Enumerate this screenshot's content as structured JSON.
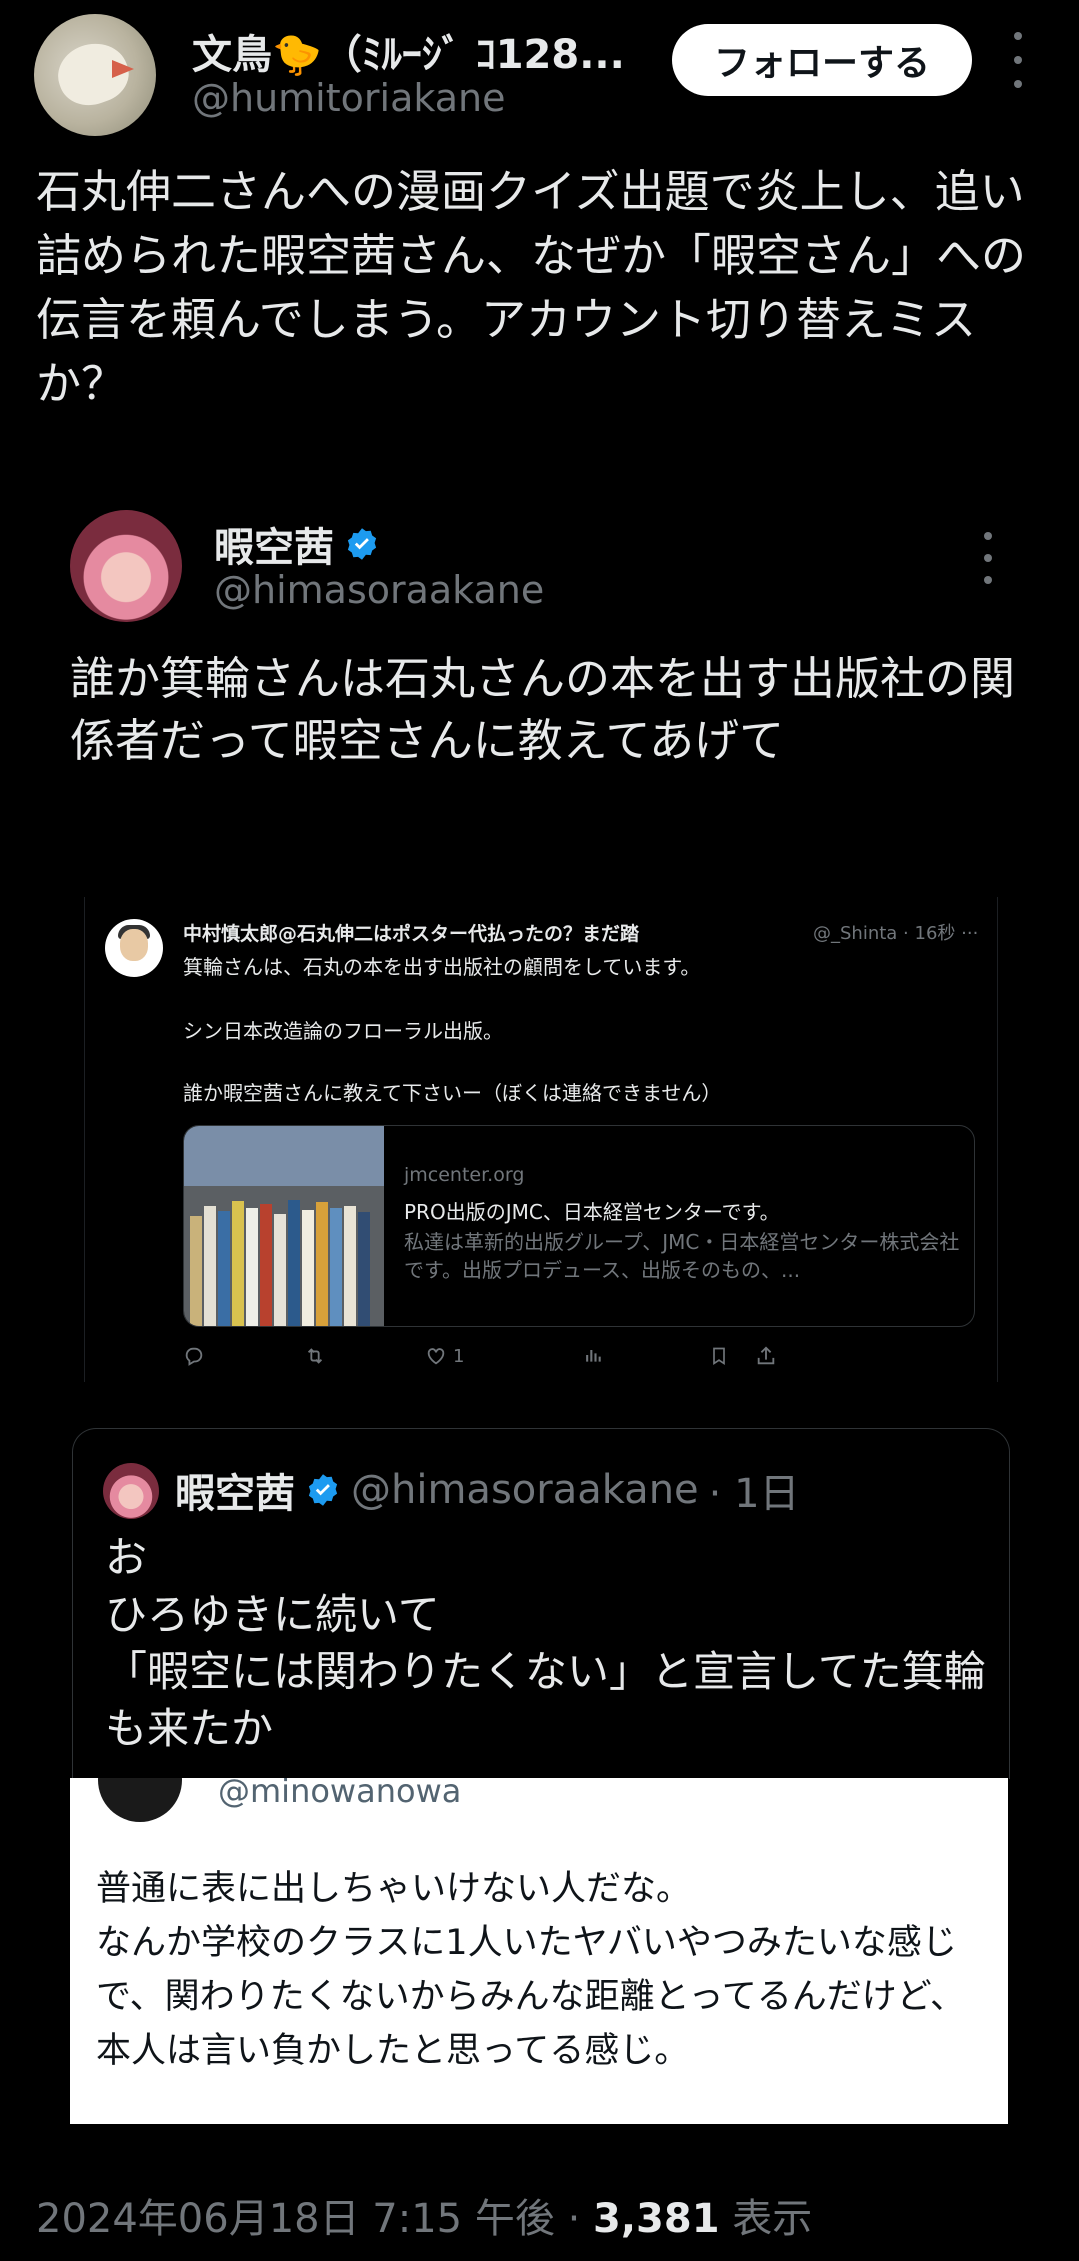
{
  "tweet": {
    "author_name": "文鳥🐤（ﾐﾙｰｼﾞ ｺ128...",
    "author_handle": "@humitoriakane",
    "follow_label": "フォローする",
    "text": "石丸伸二さんへの漫画クイズ出題で炎上し、追い詰められた暇空茜さん、なぜか「暇空さん」への伝言を頼んでしまう。アカウント切り替えミスか？",
    "date": "2024年06月18日 7:15 午後",
    "sep": " · ",
    "views": "3,381",
    "views_label": "表示"
  },
  "quoted": {
    "author_name": "暇空茜",
    "author_handle": "@himasoraakane",
    "text": "誰か箕輪さんは石丸さんの本を出す出版社の関係者だって暇空さんに教えてあげて",
    "verified_color": "#1d9bf0"
  },
  "screenshot": {
    "author": "中村慎太郎@石丸伸二はポスター代払ったの？まだ踏",
    "meta": "@_Shinta · 16秒 ···",
    "lines": [
      "箕輪さんは、石丸の本を出す出版社の顧問をしています。",
      "シン日本改造論のフローラル出版。",
      "誰か暇空茜さんに教えて下さいー（ぼくは連絡できません）"
    ],
    "card_domain": "jmcenter.org",
    "card_title": "PRO出版のJMC、日本経営センターです。",
    "card_desc": "私達は革新的出版グループ、JMC・日本経営センター株式会社です。出版プロデュース、出版そのもの、...",
    "like_count": "1"
  },
  "quote2": {
    "author_name": "暇空茜",
    "author_handle": "@himasoraakane",
    "time": "· 1日",
    "text": "お\nひろゆきに続いて\n「暇空には関わりたくない」と宣言してた箕輪も来たか"
  },
  "inner_image": {
    "handle": "@minowanowa",
    "text": "普通に表に出しちゃいけない人だな。\nなんか学校のクラスに1人いたヤバいやつみたいな感じで、関わりたくないからみんな距離とってるんだけど、本人は言い負かしたと思ってる感じ。"
  }
}
